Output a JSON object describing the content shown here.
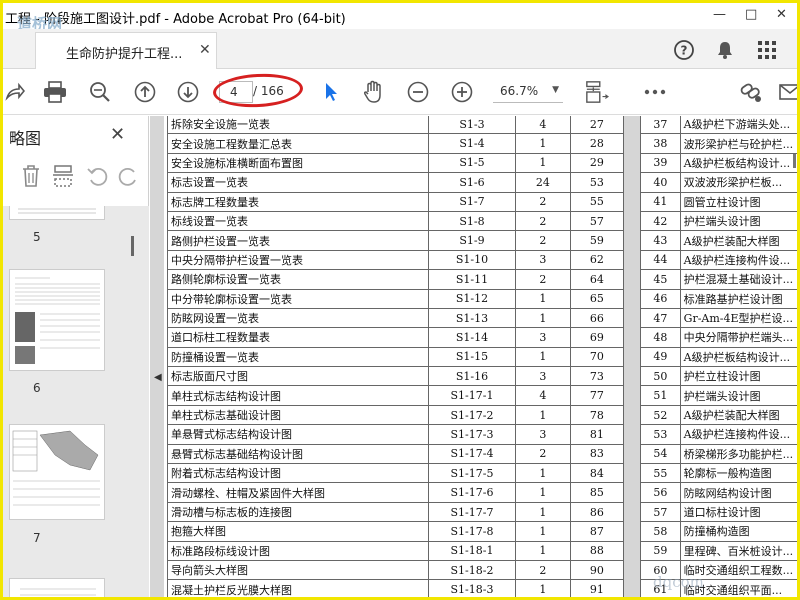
{
  "window": {
    "title": "工程 - 阶段施工图设计.pdf - Adobe Acrobat Pro (64-bit)",
    "watermark": "道桥网"
  },
  "tabs": [
    {
      "label": "生命防护提升工程..."
    }
  ],
  "toolbar": {
    "current_page": "4",
    "page_total": "/ 166",
    "zoom": "66.7%"
  },
  "left_panel": {
    "title": "略图",
    "thumbnail_labels": [
      "5",
      "6",
      "7"
    ]
  },
  "doc_left_rows": [
    {
      "name": "拆除安全设施一览表",
      "code": "S1-3",
      "sheets": "4",
      "page": "27"
    },
    {
      "name": "安全设施工程数量汇总表",
      "code": "S1-4",
      "sheets": "1",
      "page": "28"
    },
    {
      "name": "安全设施标准横断面布置图",
      "code": "S1-5",
      "sheets": "1",
      "page": "29"
    },
    {
      "name": "标志设置一览表",
      "code": "S1-6",
      "sheets": "24",
      "page": "53"
    },
    {
      "name": "标志牌工程数量表",
      "code": "S1-7",
      "sheets": "2",
      "page": "55"
    },
    {
      "name": "标线设置一览表",
      "code": "S1-8",
      "sheets": "2",
      "page": "57"
    },
    {
      "name": "路侧护栏设置一览表",
      "code": "S1-9",
      "sheets": "2",
      "page": "59"
    },
    {
      "name": "中央分隔带护栏设置一览表",
      "code": "S1-10",
      "sheets": "3",
      "page": "62"
    },
    {
      "name": "路侧轮廓标设置一览表",
      "code": "S1-11",
      "sheets": "2",
      "page": "64"
    },
    {
      "name": "中分带轮廓标设置一览表",
      "code": "S1-12",
      "sheets": "1",
      "page": "65"
    },
    {
      "name": "防眩网设置一览表",
      "code": "S1-13",
      "sheets": "1",
      "page": "66"
    },
    {
      "name": "道口标柱工程数量表",
      "code": "S1-14",
      "sheets": "3",
      "page": "69"
    },
    {
      "name": "防撞桶设置一览表",
      "code": "S1-15",
      "sheets": "1",
      "page": "70"
    },
    {
      "name": "标志版面尺寸图",
      "code": "S1-16",
      "sheets": "3",
      "page": "73"
    },
    {
      "name": "单柱式标志结构设计图",
      "code": "S1-17-1",
      "sheets": "4",
      "page": "77"
    },
    {
      "name": "单柱式标志基础设计图",
      "code": "S1-17-2",
      "sheets": "1",
      "page": "78"
    },
    {
      "name": "单悬臂式标志结构设计图",
      "code": "S1-17-3",
      "sheets": "3",
      "page": "81"
    },
    {
      "name": "悬臂式标志基础结构设计图",
      "code": "S1-17-4",
      "sheets": "2",
      "page": "83"
    },
    {
      "name": "附着式标志结构设计图",
      "code": "S1-17-5",
      "sheets": "1",
      "page": "84"
    },
    {
      "name": "滑动螺栓、柱帽及紧固件大样图",
      "code": "S1-17-6",
      "sheets": "1",
      "page": "85"
    },
    {
      "name": "滑动槽与标志板的连接图",
      "code": "S1-17-7",
      "sheets": "1",
      "page": "86"
    },
    {
      "name": "抱箍大样图",
      "code": "S1-17-8",
      "sheets": "1",
      "page": "87"
    },
    {
      "name": "标准路段标线设计图",
      "code": "S1-18-1",
      "sheets": "1",
      "page": "88"
    },
    {
      "name": "导向箭头大样图",
      "code": "S1-18-2",
      "sheets": "2",
      "page": "90"
    },
    {
      "name": "混凝土护栏反光膜大样图",
      "code": "S1-18-3",
      "sheets": "1",
      "page": "91"
    }
  ],
  "doc_right_rows": [
    {
      "no": "37",
      "name": "A级护栏下游端头处..."
    },
    {
      "no": "38",
      "name": "波形梁护栏与砼护栏..."
    },
    {
      "no": "39",
      "name": "A级护栏板结构设计..."
    },
    {
      "no": "40",
      "name": "双波波形梁护栏板..."
    },
    {
      "no": "41",
      "name": "圆管立柱设计图"
    },
    {
      "no": "42",
      "name": "护栏端头设计图"
    },
    {
      "no": "43",
      "name": "A级护栏装配大样图"
    },
    {
      "no": "44",
      "name": "A级护栏连接构件设..."
    },
    {
      "no": "45",
      "name": "护栏混凝土基础设计..."
    },
    {
      "no": "46",
      "name": "标准路基护栏设计图"
    },
    {
      "no": "47",
      "name": "Gr-Am-4E型护栏设..."
    },
    {
      "no": "48",
      "name": "中央分隔带护栏端头..."
    },
    {
      "no": "49",
      "name": "A级护栏板结构设计..."
    },
    {
      "no": "50",
      "name": "护栏立柱设计图"
    },
    {
      "no": "51",
      "name": "护栏端头设计图"
    },
    {
      "no": "52",
      "name": "A级护栏装配大样图"
    },
    {
      "no": "53",
      "name": "A级护栏连接构件设..."
    },
    {
      "no": "54",
      "name": "桥梁梯形多功能护栏..."
    },
    {
      "no": "55",
      "name": "轮廓标一般构造图"
    },
    {
      "no": "56",
      "name": "防眩网结构设计图"
    },
    {
      "no": "57",
      "name": "道口标柱设计图"
    },
    {
      "no": "58",
      "name": "防撞桶构造图"
    },
    {
      "no": "59",
      "name": "里程碑、百米桩设计..."
    },
    {
      "no": "60",
      "name": "临时交通组织工程数..."
    },
    {
      "no": "61",
      "name": "临时交通组织平面..."
    }
  ],
  "bottom_watermark": "dqcom"
}
